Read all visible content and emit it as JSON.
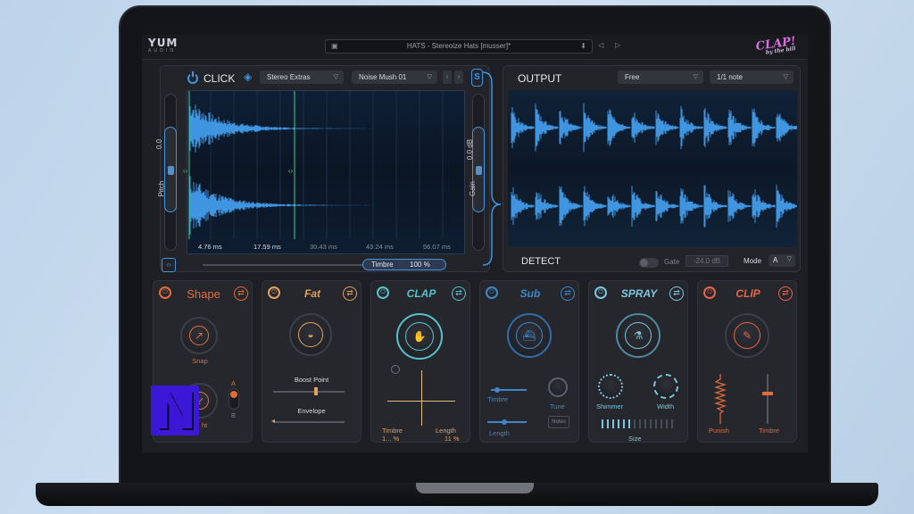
{
  "window": {
    "brand": "YUM",
    "brand_sub": "AUDIO",
    "preset_name": "HATS - Stereoize Hats [musser]*",
    "product_logo": "CLAP!",
    "product_logo_sub": "by the bill"
  },
  "click_panel": {
    "title": "CLICK",
    "category_dropdown": "Stereo Extras",
    "sample_dropdown": "Noise Mush 01",
    "pitch_label": "Pitch",
    "pitch_value": "0.0",
    "gain_label": "Gain",
    "gain_value": "0.0 dB",
    "timeline_ticks": [
      "4.76 ms",
      "17.59 ms",
      "30.43 ms",
      "43.24 ms",
      "56.07 ms"
    ],
    "timbre_label": "Timbre",
    "timbre_value": "100 %",
    "s_badge": "S"
  },
  "output_panel": {
    "title": "OUTPUT",
    "sync_dropdown": "Free",
    "rate_dropdown": "1/1 note",
    "detect_label": "DETECT",
    "gate_label": "Gate",
    "gate_value": "-24.0 dB",
    "mode_label": "Mode",
    "mode_value": "A"
  },
  "modules": [
    {
      "title": "Shape",
      "color": "#e06d3a",
      "knob_label": "Snap",
      "knob2_label": "ht",
      "switch_a": "A",
      "switch_b": "B"
    },
    {
      "title": "Fat",
      "color": "#e0a262",
      "point_label": "Boost Point",
      "envelope_label": "Envelope"
    },
    {
      "title": "CLAP",
      "color": "#55c3cf",
      "x_label": "Timbre",
      "y_label": "Length",
      "x_value": "1... %",
      "y_value": "11 %"
    },
    {
      "title": "Sub",
      "color": "#3f86c9",
      "timbre_label": "Timbre",
      "tune_label": "Tune",
      "length_label": "Length",
      "notes_value": "Notes"
    },
    {
      "title": "SPRAY",
      "color": "#7cc6dd",
      "shimmer_label": "Shimmer",
      "width_label": "Width",
      "size_label": "Size"
    },
    {
      "title": "CLIP",
      "color": "#e6654a",
      "punish_label": "Punish",
      "timbre_label": "Timbre"
    }
  ],
  "overlay": {
    "badge": "N"
  },
  "colors": {
    "accent_blue": "#3f95e0",
    "accent_green": "#3ecf8e",
    "panel_bg": "#26272d"
  }
}
